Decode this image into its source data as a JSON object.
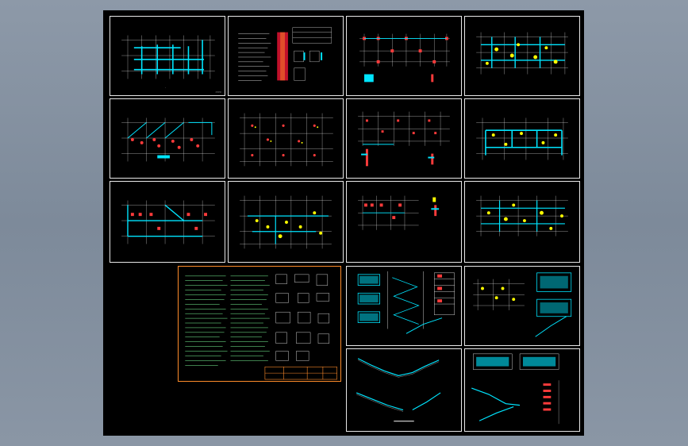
{
  "viewer": {
    "background": "#8a96a5",
    "canvas_color": "#000000"
  },
  "colors": {
    "frame": "#e8e8e8",
    "grid": "#ffffff",
    "beam": "#00e5ff",
    "column": "#ff3b3b",
    "mark": "#ffff00",
    "notes_border": "#ff8c2a",
    "notes_text": "#7dff9a"
  },
  "sheets": [
    {
      "id": "s1",
      "kind": "plan-beam"
    },
    {
      "id": "s2",
      "kind": "general-notes"
    },
    {
      "id": "s3",
      "kind": "plan-column"
    },
    {
      "id": "s4",
      "kind": "plan-slab"
    },
    {
      "id": "s5",
      "kind": "plan-column"
    },
    {
      "id": "s6",
      "kind": "plan-foundation"
    },
    {
      "id": "s7",
      "kind": "plan-column"
    },
    {
      "id": "s8",
      "kind": "plan-beam"
    },
    {
      "id": "s9",
      "kind": "plan-column"
    },
    {
      "id": "s10",
      "kind": "plan-slab"
    },
    {
      "id": "s11",
      "kind": "plan-column"
    },
    {
      "id": "s12",
      "kind": "plan-slab"
    },
    {
      "id": "s13",
      "kind": "design-notes"
    },
    {
      "id": "s14",
      "kind": "stair-detail"
    },
    {
      "id": "s15",
      "kind": "stair-plan"
    },
    {
      "id": "s16",
      "kind": "stair-section"
    },
    {
      "id": "s17",
      "kind": "stair-section"
    }
  ]
}
